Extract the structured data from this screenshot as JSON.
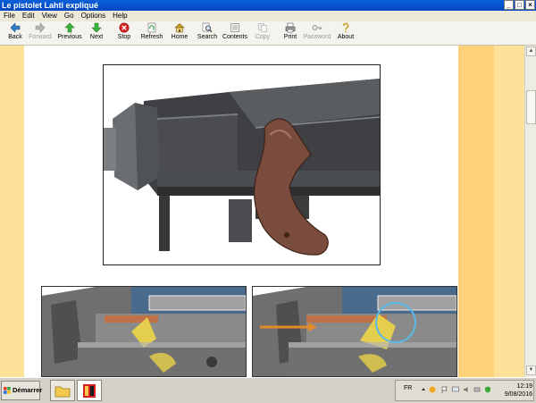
{
  "window": {
    "title": "Le pistolet Lahti expliqué"
  },
  "menu": [
    "File",
    "Edit",
    "View",
    "Go",
    "Options",
    "Help"
  ],
  "toolbar": [
    {
      "label": "Back",
      "icon": "back-arrow-icon",
      "enabled": true
    },
    {
      "label": "Forward",
      "icon": "forward-arrow-icon",
      "enabled": false
    },
    {
      "label": "Previous",
      "icon": "up-arrow-icon",
      "enabled": true
    },
    {
      "label": "Next",
      "icon": "down-arrow-icon",
      "enabled": true
    },
    {
      "label": "Stop",
      "icon": "stop-icon",
      "enabled": true
    },
    {
      "label": "Refresh",
      "icon": "refresh-icon",
      "enabled": true
    },
    {
      "label": "Home",
      "icon": "home-icon",
      "enabled": true
    },
    {
      "label": "Search",
      "icon": "search-icon",
      "enabled": true
    },
    {
      "label": "Contents",
      "icon": "contents-icon",
      "enabled": true
    },
    {
      "label": "Copy",
      "icon": "copy-icon",
      "enabled": false
    },
    {
      "label": "Print",
      "icon": "print-icon",
      "enabled": true
    },
    {
      "label": "Password",
      "icon": "key-icon",
      "enabled": false
    },
    {
      "label": "About",
      "icon": "about-icon",
      "enabled": true
    }
  ],
  "taskbar": {
    "start_label": "Démarrer",
    "language": "FR",
    "clock_time": "12:19",
    "clock_date": "9/08/2016"
  },
  "colors": {
    "page_background": "#ffe29a",
    "right_band": "#ffd27a",
    "titlebar": "#0a5fd8"
  }
}
